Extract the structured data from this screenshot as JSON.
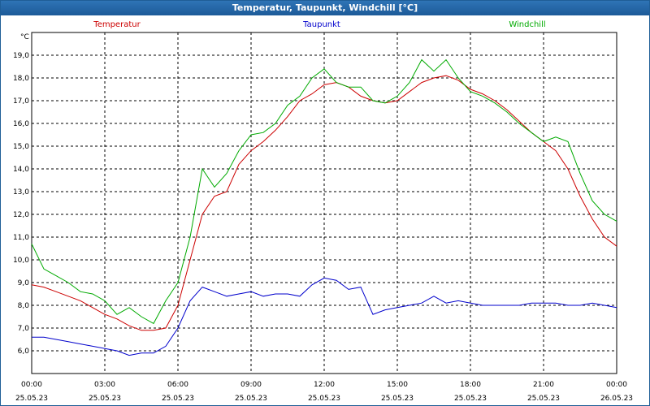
{
  "window": {
    "title": "Temperatur, Taupunkt, Windchill [°C]"
  },
  "chart_data": {
    "type": "line",
    "title": "Temperatur, Taupunkt, Windchill [°C]",
    "ylabel": "°C",
    "ylim": [
      5.0,
      20.0
    ],
    "yticks": [
      "6,0",
      "7,0",
      "8,0",
      "9,0",
      "10,0",
      "11,0",
      "12,0",
      "13,0",
      "14,0",
      "15,0",
      "16,0",
      "17,0",
      "18,0",
      "19,0"
    ],
    "xlim": [
      0,
      24
    ],
    "xticks": [
      {
        "time": "00:00",
        "date": "25.05.23"
      },
      {
        "time": "03:00",
        "date": "25.05.23"
      },
      {
        "time": "06:00",
        "date": "25.05.23"
      },
      {
        "time": "09:00",
        "date": "25.05.23"
      },
      {
        "time": "12:00",
        "date": "25.05.23"
      },
      {
        "time": "15:00",
        "date": "25.05.23"
      },
      {
        "time": "18:00",
        "date": "25.05.23"
      },
      {
        "time": "21:00",
        "date": "25.05.23"
      },
      {
        "time": "00:00",
        "date": "26.05.23"
      }
    ],
    "grid": true,
    "legend_position": "top",
    "series": [
      {
        "name": "Temperatur",
        "color": "#cc0000",
        "x": [
          0,
          0.5,
          1,
          1.5,
          2,
          2.5,
          3,
          3.5,
          4,
          4.5,
          5,
          5.5,
          6,
          6.5,
          7,
          7.5,
          8,
          8.5,
          9,
          9.5,
          10,
          10.5,
          11,
          11.5,
          12,
          12.5,
          13,
          13.5,
          14,
          14.5,
          15,
          15.5,
          16,
          16.5,
          17,
          17.5,
          18,
          18.5,
          19,
          19.5,
          20,
          20.5,
          21,
          21.5,
          22,
          22.5,
          23,
          23.5,
          24
        ],
        "values": [
          8.9,
          8.8,
          8.6,
          8.4,
          8.2,
          7.9,
          7.6,
          7.4,
          7.1,
          6.9,
          6.9,
          7.0,
          8.0,
          10.0,
          12.0,
          12.8,
          13.0,
          14.2,
          14.8,
          15.2,
          15.7,
          16.3,
          17.0,
          17.3,
          17.7,
          17.8,
          17.6,
          17.2,
          17.0,
          16.9,
          17.0,
          17.4,
          17.8,
          18.0,
          18.1,
          17.9,
          17.5,
          17.3,
          17.0,
          16.6,
          16.1,
          15.6,
          15.2,
          14.8,
          14.0,
          12.8,
          11.8,
          11.0,
          10.6
        ]
      },
      {
        "name": "Taupunkt",
        "color": "#0000cc",
        "x": [
          0,
          0.5,
          1,
          1.5,
          2,
          2.5,
          3,
          3.5,
          4,
          4.5,
          5,
          5.5,
          6,
          6.5,
          7,
          7.5,
          8,
          8.5,
          9,
          9.5,
          10,
          10.5,
          11,
          11.5,
          12,
          12.5,
          13,
          13.5,
          14,
          14.5,
          15,
          15.5,
          16,
          16.5,
          17,
          17.5,
          18,
          18.5,
          19,
          19.5,
          20,
          20.5,
          21,
          21.5,
          22,
          22.5,
          23,
          23.5,
          24
        ],
        "values": [
          6.6,
          6.6,
          6.5,
          6.4,
          6.3,
          6.2,
          6.1,
          6.0,
          5.8,
          5.9,
          5.9,
          6.2,
          7.0,
          8.2,
          8.8,
          8.6,
          8.4,
          8.5,
          8.6,
          8.4,
          8.5,
          8.5,
          8.4,
          8.9,
          9.2,
          9.1,
          8.7,
          8.8,
          7.6,
          7.8,
          7.9,
          8.0,
          8.1,
          8.4,
          8.1,
          8.2,
          8.1,
          8.0,
          8.0,
          8.0,
          8.0,
          8.1,
          8.1,
          8.1,
          8.0,
          8.0,
          8.1,
          8.0,
          7.9
        ]
      },
      {
        "name": "Windchill",
        "color": "#00aa00",
        "x": [
          0,
          0.5,
          1,
          1.5,
          2,
          2.5,
          3,
          3.5,
          4,
          4.5,
          5,
          5.5,
          6,
          6.5,
          7,
          7.5,
          8,
          8.5,
          9,
          9.5,
          10,
          10.5,
          11,
          11.5,
          12,
          12.5,
          13,
          13.5,
          14,
          14.5,
          15,
          15.5,
          16,
          16.5,
          17,
          17.5,
          18,
          18.5,
          19,
          19.5,
          20,
          20.5,
          21,
          21.5,
          22,
          22.5,
          23,
          23.5,
          24
        ],
        "values": [
          10.7,
          9.6,
          9.3,
          9.0,
          8.6,
          8.5,
          8.2,
          7.6,
          7.9,
          7.5,
          7.2,
          8.2,
          9.0,
          11.0,
          14.0,
          13.2,
          13.8,
          14.8,
          15.5,
          15.6,
          16.0,
          16.8,
          17.2,
          18.0,
          18.4,
          17.8,
          17.6,
          17.6,
          17.0,
          16.9,
          17.2,
          17.8,
          18.8,
          18.3,
          18.8,
          18.0,
          17.4,
          17.2,
          16.9,
          16.5,
          16.0,
          15.6,
          15.2,
          15.4,
          15.2,
          13.8,
          12.6,
          12.0,
          11.7
        ]
      }
    ]
  }
}
